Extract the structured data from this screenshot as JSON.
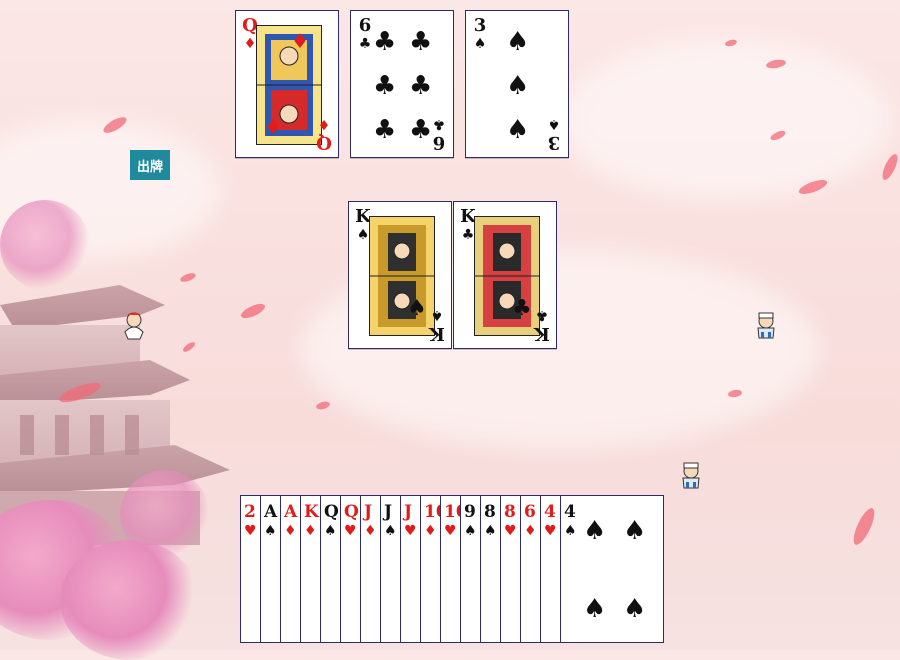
{
  "actions": {
    "play_label": "出牌"
  },
  "played_cards": [
    {
      "rank": "Q",
      "suit": "♦",
      "color": "red"
    },
    {
      "rank": "6",
      "suit": "♣",
      "color": "black"
    },
    {
      "rank": "3",
      "suit": "♠",
      "color": "black"
    }
  ],
  "center_cards": [
    {
      "rank": "K",
      "suit": "♠",
      "color": "black"
    },
    {
      "rank": "K",
      "suit": "♣",
      "color": "black"
    }
  ],
  "hand": [
    {
      "rank": "2",
      "suit": "♥",
      "color": "red"
    },
    {
      "rank": "A",
      "suit": "♠",
      "color": "black"
    },
    {
      "rank": "A",
      "suit": "♦",
      "color": "red"
    },
    {
      "rank": "K",
      "suit": "♦",
      "color": "red"
    },
    {
      "rank": "Q",
      "suit": "♠",
      "color": "black"
    },
    {
      "rank": "Q",
      "suit": "♥",
      "color": "red"
    },
    {
      "rank": "J",
      "suit": "♦",
      "color": "red"
    },
    {
      "rank": "J",
      "suit": "♠",
      "color": "black"
    },
    {
      "rank": "J",
      "suit": "♥",
      "color": "red"
    },
    {
      "rank": "10",
      "suit": "♦",
      "color": "red"
    },
    {
      "rank": "10",
      "suit": "♥",
      "color": "red"
    },
    {
      "rank": "9",
      "suit": "♠",
      "color": "black"
    },
    {
      "rank": "8",
      "suit": "♠",
      "color": "black"
    },
    {
      "rank": "8",
      "suit": "♥",
      "color": "red"
    },
    {
      "rank": "6",
      "suit": "♦",
      "color": "red"
    },
    {
      "rank": "4",
      "suit": "♥",
      "color": "red"
    },
    {
      "rank": "4",
      "suit": "♠",
      "color": "black"
    }
  ],
  "colors": {
    "button": "#1f8a9e",
    "red": "#e21b1b",
    "black": "#111111"
  },
  "icons": [
    "player-left-avatar-icon",
    "player-right-avatar-icon",
    "player-self-avatar-icon"
  ]
}
